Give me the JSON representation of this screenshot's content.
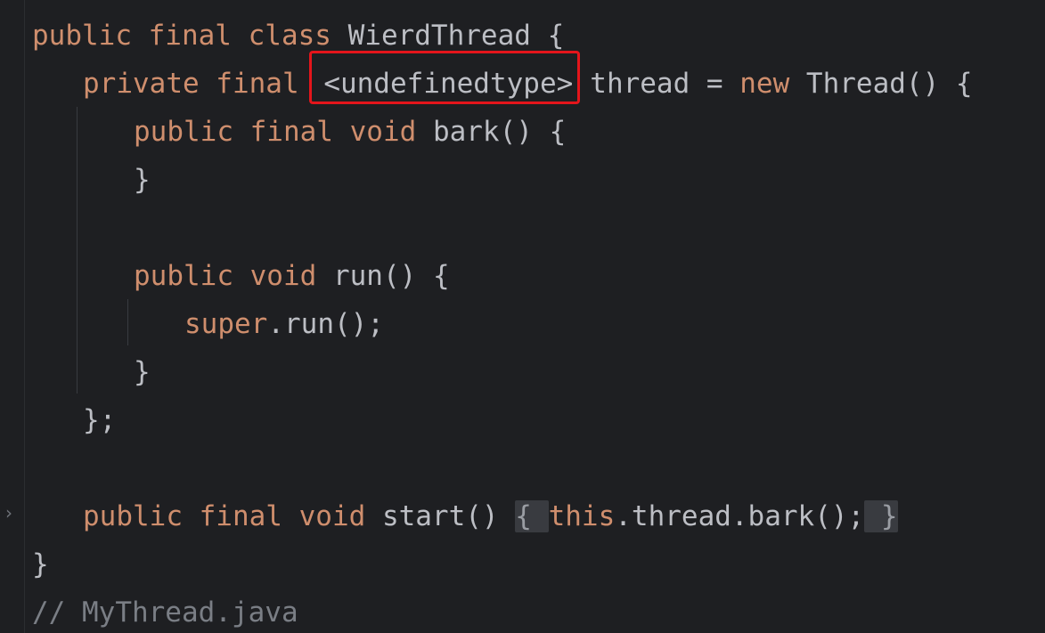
{
  "editor": {
    "lines": {
      "l1": {
        "kw1": "public final class",
        "rest": " WierdThread {"
      },
      "l2": {
        "kw1": "private final",
        "type": "<undefinedtype>",
        "mid": "thread = ",
        "kw2": "new",
        "rest": " Thread() {"
      },
      "l3": {
        "kw1": "public final void",
        "rest": " bark() {"
      },
      "l4": {
        "rest": "}"
      },
      "l5": {
        "kw1": "public void",
        "rest": " run() {"
      },
      "l6": {
        "kw1": "super",
        "rest": ".run();"
      },
      "l7": {
        "rest": "}"
      },
      "l8": {
        "rest": "};"
      },
      "l9": {
        "kw1": "public final void",
        "mid": " start() ",
        "fold_open": "{ ",
        "kw2": "this",
        "rest": ".thread.bark();",
        "fold_close": " }"
      },
      "l10": {
        "rest": "}"
      },
      "l11": {
        "comment": "// MyThread.java"
      }
    },
    "fold_marker": "›"
  },
  "colors": {
    "background": "#1e1f22",
    "keyword": "#cf8e6d",
    "text": "#bcbec4",
    "comment": "#7a7e85",
    "highlight_box": "#e4151b"
  }
}
